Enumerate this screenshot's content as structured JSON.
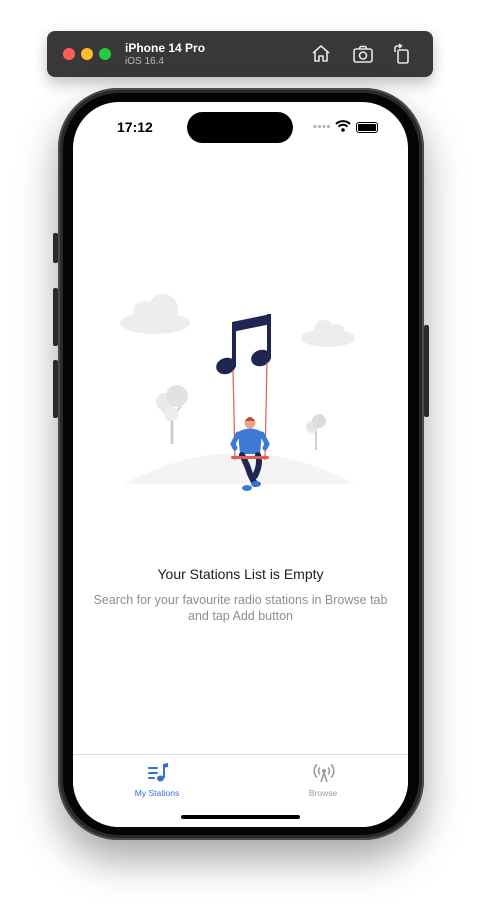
{
  "simulator": {
    "device_name": "iPhone 14 Pro",
    "os_version": "iOS 16.4",
    "toolbar_icons": [
      "home-icon",
      "screenshot-icon",
      "rotate-icon"
    ]
  },
  "status_bar": {
    "time": "17:12",
    "icons": [
      "cellular-dots-icon",
      "wifi-icon",
      "battery-icon"
    ]
  },
  "empty_state": {
    "illustration": "man-on-swing-music-note-illustration",
    "title": "Your Stations List is Empty",
    "description": "Search for your favourite radio stations in Browse tab and tap Add button"
  },
  "tab_bar": {
    "tabs": [
      {
        "label": "My Stations",
        "icon": "music-list-icon",
        "selected": true
      },
      {
        "label": "Browse",
        "icon": "antenna-icon",
        "selected": false
      }
    ]
  },
  "colors": {
    "accent": "#2f6fde",
    "tab_inactive": "#9a9aa0",
    "note": "#1f2653",
    "swing_rope": "#e05a4e"
  }
}
